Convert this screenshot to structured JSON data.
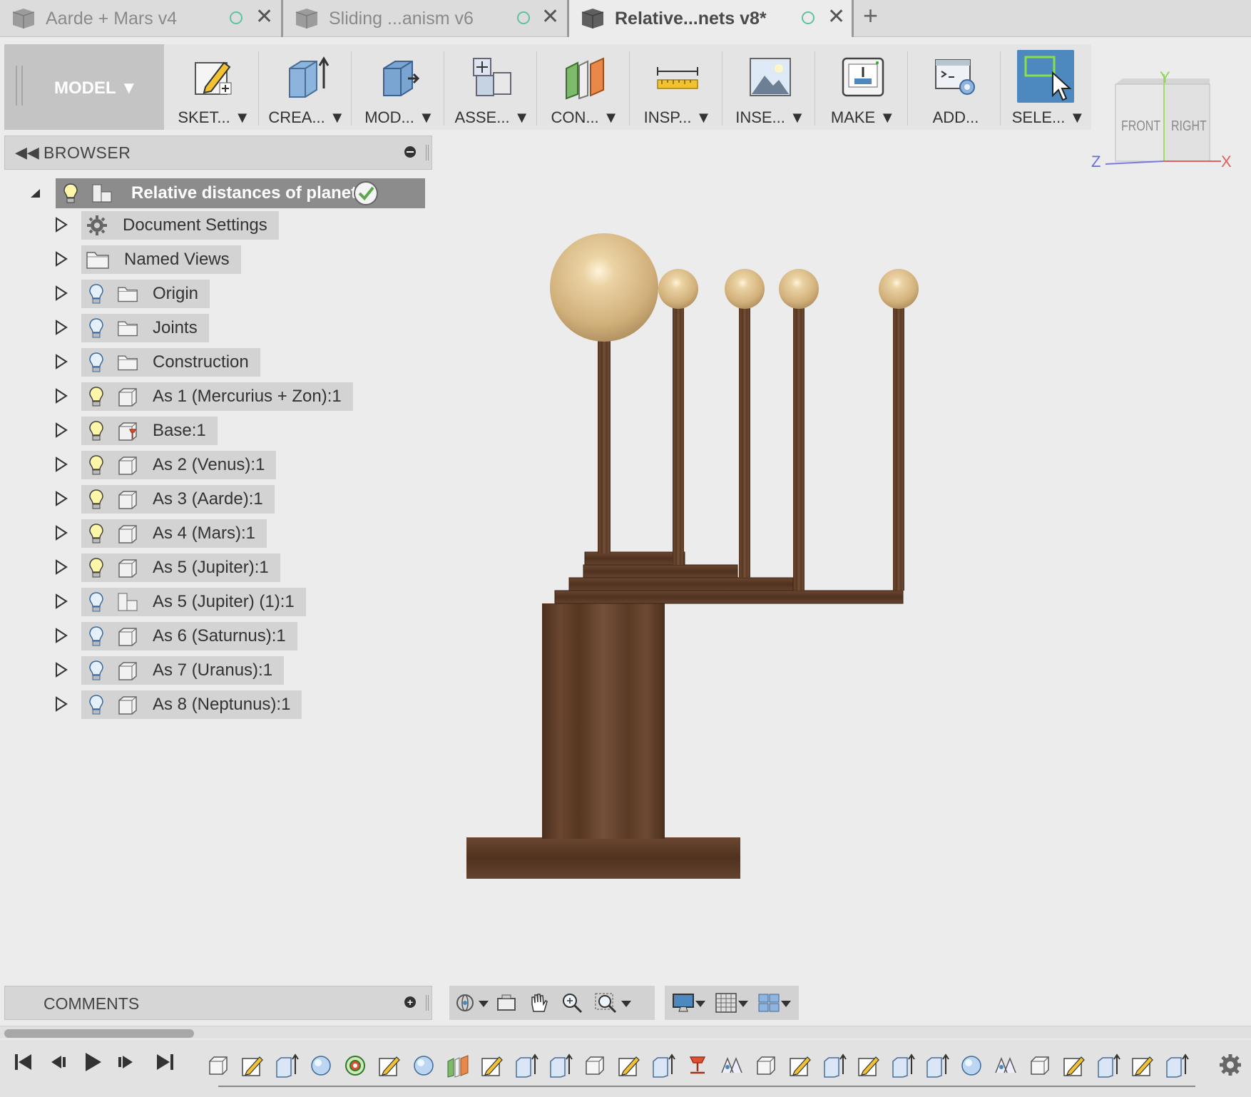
{
  "tabs": [
    {
      "title": "Aarde + Mars v4",
      "active": false
    },
    {
      "title": "Sliding ...anism v6",
      "active": false
    },
    {
      "title": "Relative...nets v8*",
      "active": true
    }
  ],
  "toolbar": {
    "workspace": "MODEL",
    "tools": [
      {
        "label": "SKET...",
        "icon": "sketch-icon"
      },
      {
        "label": "CREA...",
        "icon": "create-icon"
      },
      {
        "label": "MOD...",
        "icon": "modify-icon"
      },
      {
        "label": "ASSE...",
        "icon": "assemble-icon"
      },
      {
        "label": "CON...",
        "icon": "construct-icon"
      },
      {
        "label": "INSP...",
        "icon": "inspect-icon"
      },
      {
        "label": "INSE...",
        "icon": "insert-icon"
      },
      {
        "label": "MAKE",
        "icon": "make-icon"
      },
      {
        "label": "ADD...",
        "icon": "addins-icon"
      },
      {
        "label": "SELE...",
        "icon": "select-icon"
      }
    ]
  },
  "viewcube": {
    "front": "FRONT",
    "right": "RIGHT",
    "axis_y": "Y",
    "axis_x": "X",
    "axis_z": "Z"
  },
  "browser": {
    "title": "BROWSER",
    "root": "Relative distances of planet…",
    "items": [
      {
        "label": "Document Settings",
        "icon": "gear-icon",
        "bulb": "none"
      },
      {
        "label": "Named Views",
        "icon": "folder-icon",
        "bulb": "none"
      },
      {
        "label": "Origin",
        "icon": "folder-icon",
        "bulb": "blue"
      },
      {
        "label": "Joints",
        "icon": "folder-icon",
        "bulb": "blue"
      },
      {
        "label": "Construction",
        "icon": "folder-icon",
        "bulb": "blue"
      },
      {
        "label": "As 1 (Mercurius + Zon):1",
        "icon": "component-icon",
        "bulb": "yellow"
      },
      {
        "label": "Base:1",
        "icon": "grounded-component-icon",
        "bulb": "yellow"
      },
      {
        "label": "As 2 (Venus):1",
        "icon": "component-icon",
        "bulb": "yellow"
      },
      {
        "label": "As 3 (Aarde):1",
        "icon": "component-icon",
        "bulb": "yellow"
      },
      {
        "label": "As 4 (Mars):1",
        "icon": "component-icon",
        "bulb": "yellow"
      },
      {
        "label": "As 5 (Jupiter):1",
        "icon": "component-icon",
        "bulb": "yellow"
      },
      {
        "label": "As 5 (Jupiter) (1):1",
        "icon": "assembly-icon",
        "bulb": "blue"
      },
      {
        "label": "As 6 (Saturnus):1",
        "icon": "component-icon",
        "bulb": "blue"
      },
      {
        "label": "As 7 (Uranus):1",
        "icon": "component-icon",
        "bulb": "blue"
      },
      {
        "label": "As 8 (Neptunus):1",
        "icon": "component-icon",
        "bulb": "blue"
      }
    ]
  },
  "comments": {
    "title": "COMMENTS"
  },
  "colors": {
    "accent": "#4d88bf",
    "wood_dark": "#5a3a25",
    "sphere": "#dcc08c",
    "background": "#ececec"
  }
}
